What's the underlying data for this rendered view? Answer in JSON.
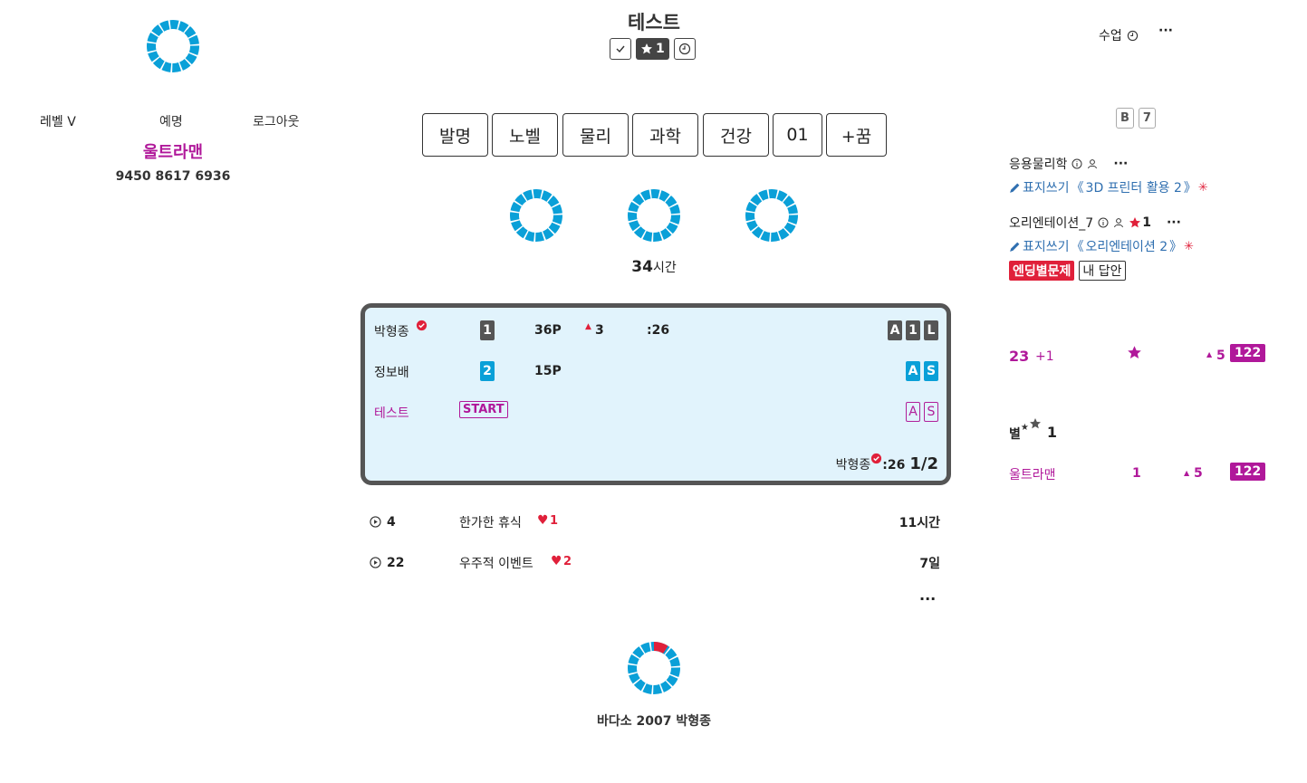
{
  "profile": {
    "level_label": "레벨 V",
    "nickname_label": "예명",
    "logout_label": "로그아웃",
    "name": "울트라맨",
    "number": "9450 8617 6936"
  },
  "header": {
    "title": "테스트",
    "star_count": "1",
    "class_label": "수업",
    "more_label": "···"
  },
  "topics": [
    "발명",
    "노벨",
    "물리",
    "과학",
    "건강",
    "01",
    "+꿈"
  ],
  "hours_value": "34",
  "hours_unit": "시간",
  "scoreboard": {
    "rows": [
      {
        "name": "박형종",
        "rank": "1",
        "points": "36P",
        "delta": "3",
        "time": ":26",
        "badges": [
          "A",
          "1",
          "L"
        ]
      },
      {
        "name": "정보배",
        "rank": "2",
        "points": "15P",
        "badges": [
          "A",
          "S"
        ]
      },
      {
        "name": "테스트",
        "start_label": "START",
        "badges": [
          "A",
          "S"
        ]
      }
    ],
    "footer_name": "박형종",
    "footer_time": ":26",
    "footer_progress": "1/2"
  },
  "activity": [
    {
      "count": "4",
      "title": "한가한 휴식",
      "hearts": "1",
      "ago": "11시간"
    },
    {
      "count": "22",
      "title": "우주적 이벤트",
      "hearts": "2",
      "ago": "7일"
    }
  ],
  "activity_more": "···",
  "footer": {
    "caption": "바다소 2007 박형종",
    "progress_fraction": 0.1
  },
  "right": {
    "keys": [
      "B",
      "7"
    ],
    "items": [
      {
        "title": "응용물리학",
        "more": "···",
        "sub_prefix": "표지쓰기",
        "sub_open": "《",
        "sub_link": "3D 프린터 활용 2",
        "sub_close": "》"
      },
      {
        "title": "오리엔테이션_7",
        "stars": "1",
        "more": "···",
        "sub_prefix": "표지쓰기",
        "sub_open": "《",
        "sub_link": "오리엔테이션 2",
        "sub_close": "》",
        "tag_primary": "엔딩별문제",
        "tag_secondary": "내 답안"
      }
    ],
    "stats": {
      "value": "23",
      "plus": "+1",
      "up": "5",
      "total": "122"
    },
    "star_section": {
      "label": "별",
      "count": "1"
    },
    "leader": {
      "name": "울트라맨",
      "count": "1",
      "up": "5",
      "total": "122"
    }
  },
  "colors": {
    "ring": "#0aa0d8",
    "magenta": "#b0189a",
    "red": "#e0203a",
    "board_bg": "#e1f3fc"
  }
}
